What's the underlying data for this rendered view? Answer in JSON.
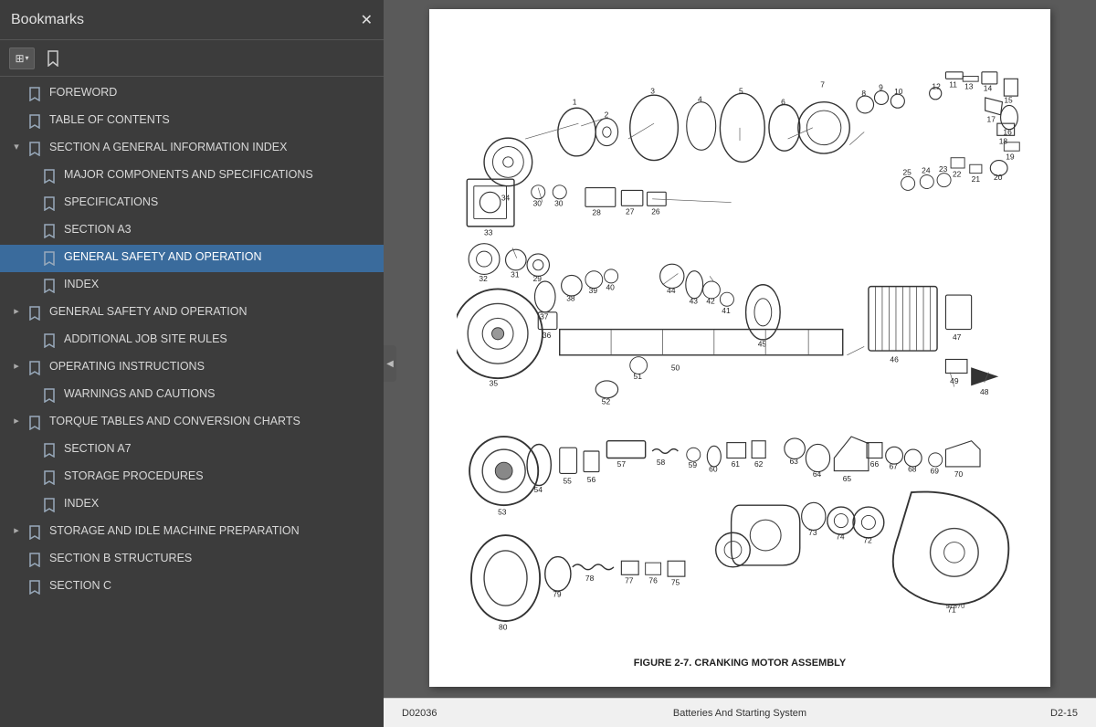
{
  "bookmarks": {
    "title": "Bookmarks",
    "close_label": "✕",
    "items": [
      {
        "id": "foreword",
        "label": "FOREWORD",
        "level": 0,
        "expandable": false,
        "expanded": false,
        "active": false
      },
      {
        "id": "toc",
        "label": "TABLE OF CONTENTS",
        "level": 0,
        "expandable": false,
        "expanded": false,
        "active": false
      },
      {
        "id": "section-a",
        "label": "SECTION A GENERAL INFORMATION INDEX",
        "level": 0,
        "expandable": true,
        "expanded": true,
        "active": false
      },
      {
        "id": "major-components",
        "label": "MAJOR COMPONENTS AND SPECIFICATIONS",
        "level": 1,
        "expandable": false,
        "expanded": false,
        "active": false
      },
      {
        "id": "specifications",
        "label": "SPECIFICATIONS",
        "level": 1,
        "expandable": false,
        "expanded": false,
        "active": false
      },
      {
        "id": "section-a3",
        "label": "SECTION A3",
        "level": 1,
        "expandable": false,
        "expanded": false,
        "active": false
      },
      {
        "id": "general-safety-op-1",
        "label": "GENERAL SAFETY AND OPERATION",
        "level": 1,
        "expandable": false,
        "expanded": false,
        "active": true
      },
      {
        "id": "index-1",
        "label": "INDEX",
        "level": 1,
        "expandable": false,
        "expanded": false,
        "active": false
      },
      {
        "id": "general-safety-op-2",
        "label": "GENERAL SAFETY AND OPERATION",
        "level": 0,
        "expandable": true,
        "expanded": false,
        "active": false
      },
      {
        "id": "additional-job-site",
        "label": "ADDITIONAL JOB SITE RULES",
        "level": 1,
        "expandable": false,
        "expanded": false,
        "active": false
      },
      {
        "id": "operating-instructions",
        "label": "OPERATING INSTRUCTIONS",
        "level": 0,
        "expandable": true,
        "expanded": false,
        "active": false
      },
      {
        "id": "warnings-cautions",
        "label": "WARNINGS AND CAUTIONS",
        "level": 1,
        "expandable": false,
        "expanded": false,
        "active": false
      },
      {
        "id": "torque-tables",
        "label": "TORQUE TABLES AND CONVERSION CHARTS",
        "level": 0,
        "expandable": true,
        "expanded": false,
        "active": false
      },
      {
        "id": "section-a7",
        "label": "SECTION A7",
        "level": 1,
        "expandable": false,
        "expanded": false,
        "active": false
      },
      {
        "id": "storage-procedures",
        "label": "STORAGE PROCEDURES",
        "level": 1,
        "expandable": false,
        "expanded": false,
        "active": false
      },
      {
        "id": "index-2",
        "label": "INDEX",
        "level": 1,
        "expandable": false,
        "expanded": false,
        "active": false
      },
      {
        "id": "storage-idle",
        "label": "STORAGE AND IDLE MACHINE PREPARATION",
        "level": 0,
        "expandable": true,
        "expanded": false,
        "active": false
      },
      {
        "id": "section-b",
        "label": "SECTION B STRUCTURES",
        "level": 0,
        "expandable": false,
        "expanded": false,
        "active": false
      },
      {
        "id": "section-c",
        "label": "SECTION C",
        "level": 0,
        "expandable": false,
        "expanded": false,
        "active": false
      }
    ]
  },
  "toolbar": {
    "grid_icon": "⊞",
    "bookmark_icon": "🔖"
  },
  "document": {
    "figure_caption": "FIGURE 2-7. CRANKING MOTOR ASSEMBLY",
    "footer_doc_id": "D02036",
    "footer_section": "Batteries And Starting System",
    "footer_page": "D2-15"
  },
  "collapse_arrow": "◀"
}
